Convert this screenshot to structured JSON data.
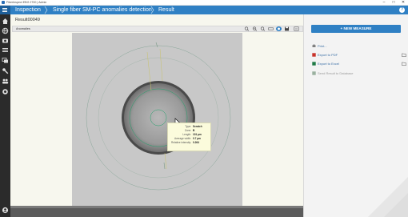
{
  "window": {
    "title": "FiberInspect EBG 2700 | Admin",
    "controls": [
      "–",
      "□",
      "✕"
    ]
  },
  "header": {
    "breadcrumbs": [
      "Inspection",
      "Single fiber SM-PC anomalies detection",
      "Result"
    ],
    "help_icon": "question-icon",
    "help_label": "?"
  },
  "sidebar": {
    "items": [
      {
        "name": "home",
        "icon": "home-icon"
      },
      {
        "name": "globe",
        "icon": "globe-icon"
      },
      {
        "name": "inspection",
        "icon": "camera-icon"
      },
      {
        "name": "results",
        "icon": "list-icon"
      },
      {
        "name": "files",
        "icon": "folder-stack-icon"
      },
      {
        "name": "tools",
        "icon": "wrench-icon"
      },
      {
        "name": "users",
        "icon": "users-icon"
      },
      {
        "name": "support",
        "icon": "lifebuoy-icon"
      }
    ],
    "bottom_icon": "user-avatar-icon"
  },
  "main": {
    "result_title": "Result00049",
    "panel_label": "Anomalies",
    "toolbar": [
      "zoom-out-icon",
      "zoom-in-icon",
      "zoom-fit-icon",
      "ruler-icon",
      "layers-icon",
      "save-icon",
      "export-icon"
    ],
    "tooltip": {
      "rows": [
        {
          "k": "Type:",
          "v": "Scratch"
        },
        {
          "k": "Zone:",
          "v": "B"
        },
        {
          "k": "Length:",
          "v": "101 µm"
        },
        {
          "k": "Average width:",
          "v": "0.7 µm"
        },
        {
          "k": "Relative intensity:",
          "v": "0.264"
        }
      ]
    }
  },
  "right_panel": {
    "new_measure_label": "+ NEW MEASURE",
    "actions": [
      {
        "label": "Print...",
        "icon": "printer-icon",
        "enabled": true,
        "folder": false
      },
      {
        "label": "Export to PDF",
        "icon": "pdf-icon",
        "enabled": true,
        "folder": true
      },
      {
        "label": "Export to Excel",
        "icon": "excel-icon",
        "enabled": true,
        "folder": true
      },
      {
        "label": "Send Result to Database",
        "icon": "database-icon",
        "enabled": false,
        "folder": false
      }
    ]
  },
  "colors": {
    "accent": "#2f80c4",
    "sidebar": "#2b2b2b",
    "fiber_inner": "#1fa36b",
    "scratch": "#c9c36a"
  }
}
